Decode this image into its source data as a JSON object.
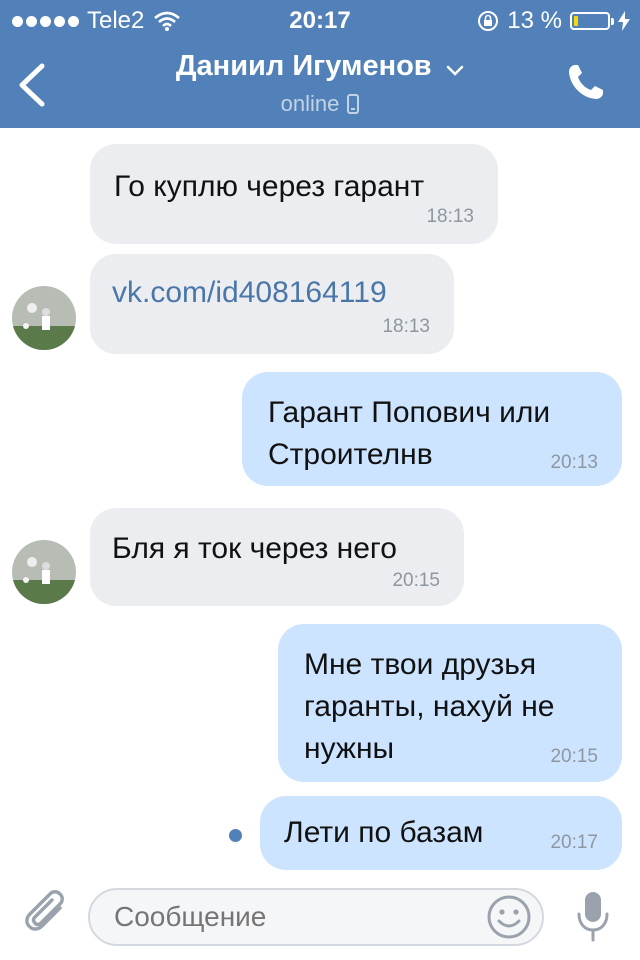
{
  "status_bar": {
    "carrier": "Tele2",
    "time": "20:17",
    "battery_text": "13 %",
    "battery_level": 0.13
  },
  "header": {
    "contact_name": "Даниил Игуменов",
    "status": "online"
  },
  "messages": [
    {
      "dir": "in",
      "text": "Го куплю через гарант",
      "time": "18:13"
    },
    {
      "dir": "in",
      "text": "vk.com/id408164119",
      "time": "18:13",
      "is_link": true
    },
    {
      "dir": "out",
      "text1": "Гарант Попович или",
      "text2": "Строителнв",
      "time": "20:13"
    },
    {
      "dir": "in",
      "text": "Бля я ток через него",
      "time": "20:15"
    },
    {
      "dir": "out",
      "text1": "Мне твои друзья",
      "text2": "гаранты, нахуй не",
      "text3": "нужны",
      "time": "20:15"
    },
    {
      "dir": "out",
      "text": "Лети по базам",
      "time": "20:17",
      "unread": true
    }
  ],
  "composer": {
    "placeholder": "Сообщение"
  },
  "colors": {
    "header": "#5181b8",
    "incoming": "#ebedf0",
    "outgoing": "#cce4ff",
    "link": "#4a76a8"
  },
  "icons": [
    "back-arrow-icon",
    "chevron-down-icon",
    "phone-call-icon",
    "paperclip-icon",
    "smile-icon",
    "microphone-icon"
  ]
}
